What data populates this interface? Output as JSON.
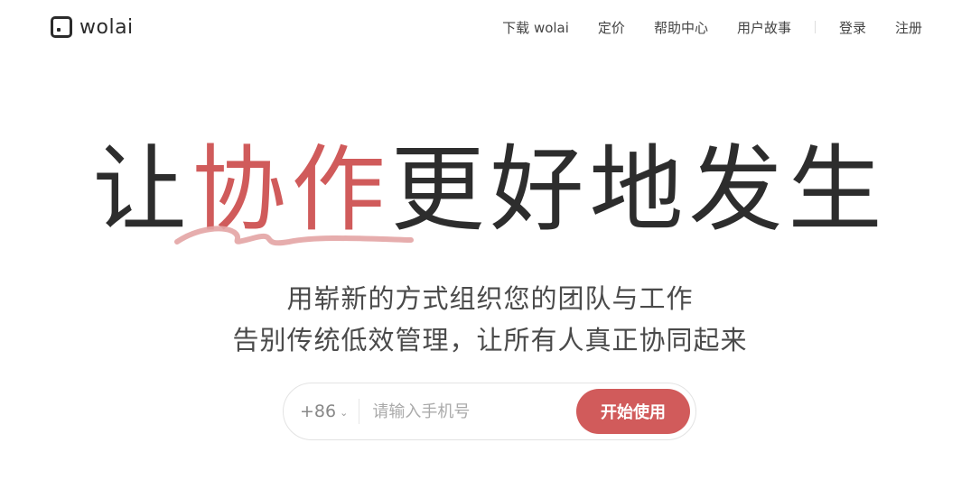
{
  "brand": {
    "name": "wolai",
    "logo_icon": "square-dot-logo-icon"
  },
  "nav": {
    "download": "下载 wolai",
    "pricing": "定价",
    "help": "帮助中心",
    "stories": "用户故事",
    "login": "登录",
    "register": "注册"
  },
  "hero": {
    "title_prefix": "让",
    "title_accent": "协作",
    "title_suffix": "更好地发生",
    "subtitle_line1": "用崭新的方式组织您的团队与工作",
    "subtitle_line2": "告别传统低效管理，让所有人真正协同起来"
  },
  "signup": {
    "country_code": "+86",
    "phone_placeholder": "请输入手机号",
    "phone_value": "",
    "cta_label": "开始使用"
  },
  "colors": {
    "accent": "#d15b5b",
    "text": "#2d2d2d",
    "squiggle": "#e3a4a4"
  }
}
